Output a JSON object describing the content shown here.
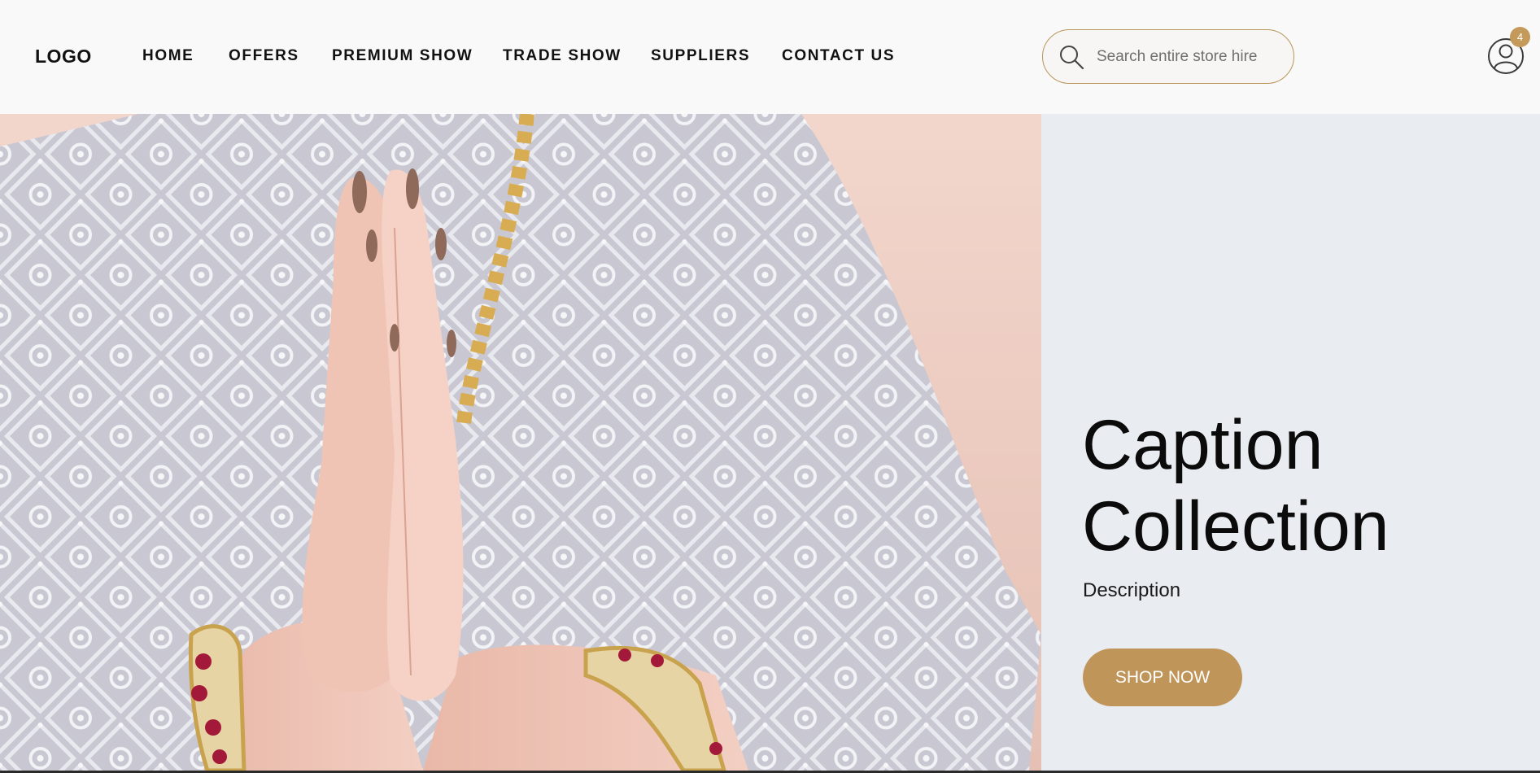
{
  "header": {
    "logo": "LOGO",
    "nav": [
      {
        "label": "HOME"
      },
      {
        "label": "OFFERS"
      },
      {
        "label": "PREMIUM SHOW"
      },
      {
        "label": "TRADE SHOW"
      },
      {
        "label": "SUPPLIERS"
      },
      {
        "label": "CONTACT US"
      }
    ],
    "search": {
      "placeholder": "Search entire store hire",
      "value": "",
      "icon": "search-icon"
    },
    "account": {
      "icon": "user-icon",
      "badge_count": "4"
    }
  },
  "hero": {
    "caption_line1": "Caption",
    "caption_line2": "Collection",
    "description": "Description",
    "cta_label": "SHOP NOW",
    "image_subject": "hands in prayer pose wearing silver embroidered fabric with gold jewelry"
  },
  "colors": {
    "accent": "#c0955a",
    "header_bg": "#f9f9f9",
    "hero_bg": "#e9edf1"
  }
}
